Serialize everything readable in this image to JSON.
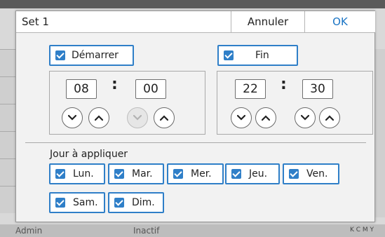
{
  "background": {
    "status_user": "Admin",
    "status_state": "Inactif",
    "ink_labels": "K C M Y"
  },
  "dialog": {
    "title": "Set 1",
    "cancel_label": "Annuler",
    "ok_label": "OK"
  },
  "start": {
    "label": "Démarrer",
    "checked": true,
    "hour": "08",
    "minute": "00",
    "minute_down_enabled": false
  },
  "end": {
    "label": "Fin",
    "checked": true,
    "hour": "22",
    "minute": "30"
  },
  "days": {
    "section_label": "Jour à appliquer",
    "items": [
      {
        "label": "Lun.",
        "checked": true
      },
      {
        "label": "Mar.",
        "checked": true
      },
      {
        "label": "Mer.",
        "checked": true
      },
      {
        "label": "Jeu.",
        "checked": true
      },
      {
        "label": "Ven.",
        "checked": true
      },
      {
        "label": "Sam.",
        "checked": true
      },
      {
        "label": "Dim.",
        "checked": true
      }
    ]
  },
  "colors": {
    "accent": "#2f7fc8",
    "ok_text": "#1a74c4"
  }
}
